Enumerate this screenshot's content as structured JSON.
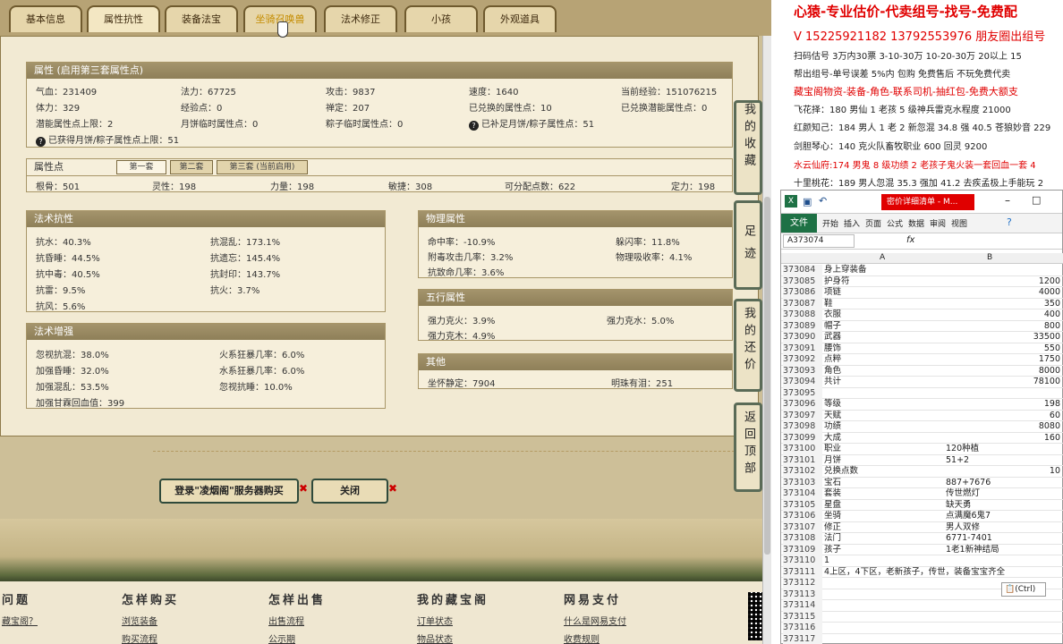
{
  "tabs": [
    "基本信息",
    "属性抗性",
    "装备法宝",
    "坐骑召唤兽",
    "法术修正",
    "小孩",
    "外观道具"
  ],
  "attr": {
    "title": "属性 (启用第三套属性点)",
    "rows": [
      [
        "气血：231409",
        "法力：67725",
        "攻击：9837",
        "速度：1640",
        "当前经验：151076215"
      ],
      [
        "体力：329",
        "经验点：0",
        "禅定：207",
        "已兑换的属性点：10",
        "已兑换潜能属性点：0"
      ],
      [
        "潜能属性点上限：2",
        "月饼临时属性点：0",
        "粽子临时属性点：0",
        "已补足月饼/粽子属性点：51"
      ],
      [
        "已获得月饼/粽子属性点上限：51"
      ]
    ]
  },
  "points": {
    "title": "属性点",
    "subtabs": [
      "第一套",
      "第二套",
      "第三套 (当前启用)"
    ],
    "values": [
      "根骨：501",
      "灵性：198",
      "力量：198",
      "敏捷：308",
      "可分配点数：622",
      "定力：198"
    ]
  },
  "magic_res": {
    "title": "法术抗性",
    "rows": [
      [
        "抗水：40.3%",
        "抗混乱：173.1%"
      ],
      [
        "抗昏睡：44.5%",
        "抗遗忘：145.4%"
      ],
      [
        "抗中毒：40.5%",
        "抗封印：143.7%"
      ],
      [
        "抗雷：9.5%",
        "抗火：3.7%"
      ],
      [
        "抗风：5.6%",
        ""
      ]
    ]
  },
  "magic_boost": {
    "title": "法术增强",
    "rows": [
      [
        "忽视抗混：38.0%",
        "火系狂暴几率：6.0%"
      ],
      [
        "加强昏睡：32.0%",
        "水系狂暴几率：6.0%"
      ],
      [
        "加强混乱：53.5%",
        "忽视抗睡：10.0%"
      ],
      [
        "加强甘霖回血值：399",
        ""
      ]
    ]
  },
  "phys": {
    "title": "物理属性",
    "rows": [
      [
        "命中率：-10.9%",
        "躲闪率：11.8%"
      ],
      [
        "附毒攻击几率：3.2%",
        "物理吸收率：4.1%"
      ],
      [
        "抗致命几率：3.6%",
        ""
      ]
    ]
  },
  "five": {
    "title": "五行属性",
    "rows": [
      [
        "强力克火：3.9%",
        "强力克水：5.0%"
      ],
      [
        "强力克木：4.9%",
        ""
      ]
    ]
  },
  "other": {
    "title": "其他",
    "rows": [
      [
        "坐怀静定：7904",
        "明珠有泪：251"
      ]
    ]
  },
  "buttons": {
    "buy": "登录\"凌烟阁\"服务器购买",
    "close": "关闭"
  },
  "sidebar": [
    "我的收藏",
    "足迹",
    "我的还价",
    "返回顶部"
  ],
  "footer": {
    "heads": [
      "问题",
      "怎样购买",
      "怎样出售",
      "我的藏宝阁",
      "网易支付"
    ],
    "links1": [
      "藏宝阁？",
      "浏览装备",
      "出售流程",
      "订单状态",
      "什么是网易支付"
    ],
    "links2": [
      "",
      "购买流程",
      "公示期",
      "物品状态",
      "收费规则"
    ]
  },
  "ads": [
    {
      "text": "心猿-专业估价-代卖组号-找号-免费配",
      "color": "#e00000"
    },
    {
      "text": "V 15225921182   13792553976 朋友圈出组号",
      "color": "#e00000"
    },
    {
      "text": "扫码估号 3万内30票 3-10-30万 10-20-30万 20以上 15",
      "color": "#222"
    },
    {
      "text": "帮出组号-单号误差 5%内 包购 免费售后 不玩免费代卖",
      "color": "#222"
    },
    {
      "text": "藏宝阁物资-装备-角色-联系司机-抽红包-免费大额支",
      "color": "#e00000"
    },
    {
      "text": "飞花择：180 男仙 1 老孩 5 级神兵雷克水程度 21000",
      "color": "#222"
    },
    {
      "text": "红颜知己：184 男人 1 老 2 新忽混 34.8 强 40.5 苍狼妙音 229",
      "color": "#222"
    },
    {
      "text": "剑胆琴心：140 克火队畜牧职业 600 回灵 9200",
      "color": "#222"
    },
    {
      "text": "水云仙府:174 男鬼 8 级功绩 2 老孩子鬼火装一套回血一套 4",
      "color": "#e00000"
    },
    {
      "text": "十里桃花：189 男人忽混 35.3 强加 41.2 去疾孟极上手能玩 2",
      "color": "#222"
    }
  ],
  "excel": {
    "title": "密价详细清单 - M...",
    "ribbon": [
      "文件",
      "开始",
      "插入",
      "页面",
      "公式",
      "数据",
      "审阅",
      "视图"
    ],
    "namebox": "A373074",
    "fx": "fx",
    "col_a": "A",
    "col_b": "B",
    "paste": "(Ctrl)",
    "rows": [
      [
        "373084",
        "身上穿装备",
        ""
      ],
      [
        "373085",
        "护身符",
        "1200"
      ],
      [
        "373086",
        "项链",
        "4000"
      ],
      [
        "373087",
        "鞋",
        "350"
      ],
      [
        "373088",
        "衣服",
        "400"
      ],
      [
        "373089",
        "帽子",
        "800"
      ],
      [
        "373090",
        "武器",
        "33500"
      ],
      [
        "373091",
        "腰饰",
        "550"
      ],
      [
        "373092",
        "点粹",
        "1750"
      ],
      [
        "373093",
        "角色",
        "8000"
      ],
      [
        "373094",
        "共计",
        "78100"
      ],
      [
        "373095",
        "",
        ""
      ],
      [
        "373096",
        "等级",
        "198"
      ],
      [
        "373097",
        "天赋",
        "60"
      ],
      [
        "373098",
        "功绩",
        "8080"
      ],
      [
        "373099",
        "大成",
        "160"
      ],
      [
        "373100",
        "职业",
        "120种植"
      ],
      [
        "373101",
        "月饼",
        "51+2"
      ],
      [
        "373102",
        "兑换点数",
        "10"
      ],
      [
        "373103",
        "宝石",
        "887+7676"
      ],
      [
        "373104",
        "套装",
        "传世燃灯"
      ],
      [
        "373105",
        "星盘",
        "缺天勇"
      ],
      [
        "373106",
        "坐骑",
        "点满魔6鬼7"
      ],
      [
        "373107",
        "修正",
        "男人双修"
      ],
      [
        "373108",
        "法门",
        "6771-7401"
      ],
      [
        "373109",
        "孩子",
        "1老1新神结局"
      ],
      [
        "373110",
        "1",
        ""
      ],
      [
        "373111",
        "4上区，4下区，老新孩子，传世，装备宝宝齐全",
        ""
      ],
      [
        "373112",
        "",
        ""
      ],
      [
        "373113",
        "",
        ""
      ],
      [
        "373114",
        "",
        ""
      ],
      [
        "373115",
        "",
        ""
      ],
      [
        "373116",
        "",
        ""
      ],
      [
        "373117",
        "",
        ""
      ]
    ]
  }
}
